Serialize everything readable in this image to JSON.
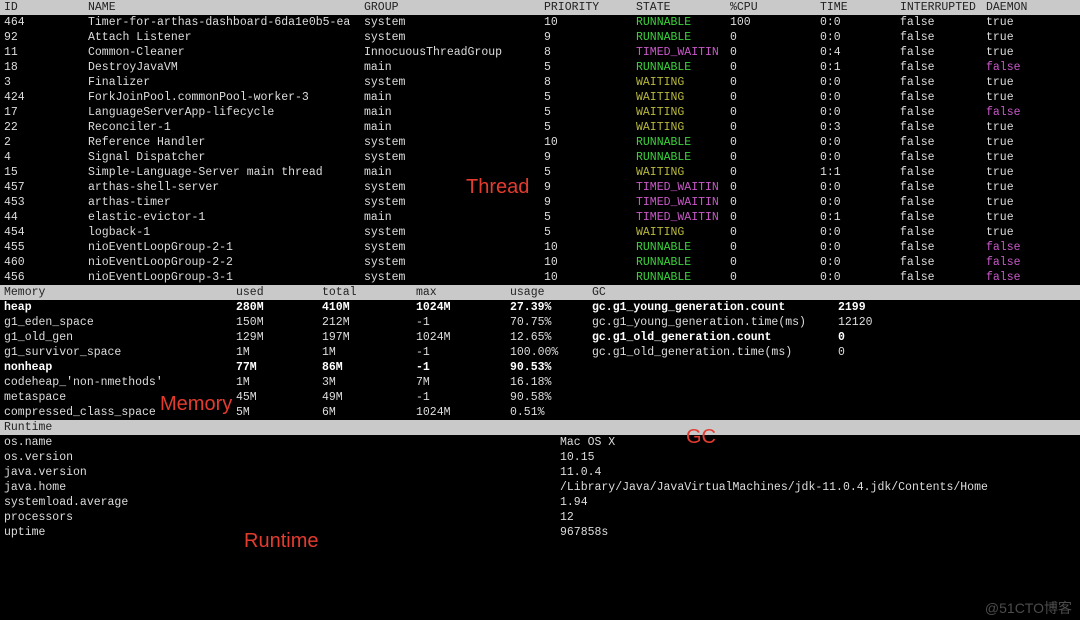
{
  "thread": {
    "headers": {
      "id": "ID",
      "name": "NAME",
      "group": "GROUP",
      "priority": "PRIORITY",
      "state": "STATE",
      "cpu": "%CPU",
      "time": "TIME",
      "interrupted": "INTERRUPTED",
      "daemon": "DAEMON"
    },
    "rows": [
      {
        "id": "464",
        "name": "Timer-for-arthas-dashboard-6da1e0b5-ea",
        "group": "system",
        "priority": "10",
        "state": "RUNNABLE",
        "state_c": "green",
        "cpu": "100",
        "time": "0:0",
        "interrupted": "false",
        "daemon": "true",
        "daemon_c": ""
      },
      {
        "id": "92",
        "name": "Attach Listener",
        "group": "system",
        "priority": "9",
        "state": "RUNNABLE",
        "state_c": "green",
        "cpu": "0",
        "time": "0:0",
        "interrupted": "false",
        "daemon": "true",
        "daemon_c": ""
      },
      {
        "id": "11",
        "name": "Common-Cleaner",
        "group": "InnocuousThreadGroup",
        "priority": "8",
        "state": "TIMED_WAITIN",
        "state_c": "magenta",
        "cpu": "0",
        "time": "0:4",
        "interrupted": "false",
        "daemon": "true",
        "daemon_c": ""
      },
      {
        "id": "18",
        "name": "DestroyJavaVM",
        "group": "main",
        "priority": "5",
        "state": "RUNNABLE",
        "state_c": "green",
        "cpu": "0",
        "time": "0:1",
        "interrupted": "false",
        "daemon": "false",
        "daemon_c": "magenta"
      },
      {
        "id": "3",
        "name": "Finalizer",
        "group": "system",
        "priority": "8",
        "state": "WAITING",
        "state_c": "olive",
        "cpu": "0",
        "time": "0:0",
        "interrupted": "false",
        "daemon": "true",
        "daemon_c": ""
      },
      {
        "id": "424",
        "name": "ForkJoinPool.commonPool-worker-3",
        "group": "main",
        "priority": "5",
        "state": "WAITING",
        "state_c": "olive",
        "cpu": "0",
        "time": "0:0",
        "interrupted": "false",
        "daemon": "true",
        "daemon_c": ""
      },
      {
        "id": "17",
        "name": "LanguageServerApp-lifecycle",
        "group": "main",
        "priority": "5",
        "state": "WAITING",
        "state_c": "olive",
        "cpu": "0",
        "time": "0:0",
        "interrupted": "false",
        "daemon": "false",
        "daemon_c": "magenta"
      },
      {
        "id": "22",
        "name": "Reconciler-1",
        "group": "main",
        "priority": "5",
        "state": "WAITING",
        "state_c": "olive",
        "cpu": "0",
        "time": "0:3",
        "interrupted": "false",
        "daemon": "true",
        "daemon_c": ""
      },
      {
        "id": "2",
        "name": "Reference Handler",
        "group": "system",
        "priority": "10",
        "state": "RUNNABLE",
        "state_c": "green",
        "cpu": "0",
        "time": "0:0",
        "interrupted": "false",
        "daemon": "true",
        "daemon_c": ""
      },
      {
        "id": "4",
        "name": "Signal Dispatcher",
        "group": "system",
        "priority": "9",
        "state": "RUNNABLE",
        "state_c": "green",
        "cpu": "0",
        "time": "0:0",
        "interrupted": "false",
        "daemon": "true",
        "daemon_c": ""
      },
      {
        "id": "15",
        "name": "Simple-Language-Server main thread",
        "group": "main",
        "priority": "5",
        "state": "WAITING",
        "state_c": "olive",
        "cpu": "0",
        "time": "1:1",
        "interrupted": "false",
        "daemon": "true",
        "daemon_c": ""
      },
      {
        "id": "457",
        "name": "arthas-shell-server",
        "group": "system",
        "priority": "9",
        "state": "TIMED_WAITIN",
        "state_c": "magenta",
        "cpu": "0",
        "time": "0:0",
        "interrupted": "false",
        "daemon": "true",
        "daemon_c": ""
      },
      {
        "id": "453",
        "name": "arthas-timer",
        "group": "system",
        "priority": "9",
        "state": "TIMED_WAITIN",
        "state_c": "magenta",
        "cpu": "0",
        "time": "0:0",
        "interrupted": "false",
        "daemon": "true",
        "daemon_c": ""
      },
      {
        "id": "44",
        "name": "elastic-evictor-1",
        "group": "main",
        "priority": "5",
        "state": "TIMED_WAITIN",
        "state_c": "magenta",
        "cpu": "0",
        "time": "0:1",
        "interrupted": "false",
        "daemon": "true",
        "daemon_c": ""
      },
      {
        "id": "454",
        "name": "logback-1",
        "group": "system",
        "priority": "5",
        "state": "WAITING",
        "state_c": "olive",
        "cpu": "0",
        "time": "0:0",
        "interrupted": "false",
        "daemon": "true",
        "daemon_c": ""
      },
      {
        "id": "455",
        "name": "nioEventLoopGroup-2-1",
        "group": "system",
        "priority": "10",
        "state": "RUNNABLE",
        "state_c": "green",
        "cpu": "0",
        "time": "0:0",
        "interrupted": "false",
        "daemon": "false",
        "daemon_c": "magenta"
      },
      {
        "id": "460",
        "name": "nioEventLoopGroup-2-2",
        "group": "system",
        "priority": "10",
        "state": "RUNNABLE",
        "state_c": "green",
        "cpu": "0",
        "time": "0:0",
        "interrupted": "false",
        "daemon": "false",
        "daemon_c": "magenta"
      },
      {
        "id": "456",
        "name": "nioEventLoopGroup-3-1",
        "group": "system",
        "priority": "10",
        "state": "RUNNABLE",
        "state_c": "green",
        "cpu": "0",
        "time": "0:0",
        "interrupted": "false",
        "daemon": "false",
        "daemon_c": "magenta"
      }
    ]
  },
  "mem": {
    "headers": {
      "name": "Memory",
      "used": "used",
      "total": "total",
      "max": "max",
      "usage": "usage",
      "gc": "GC"
    },
    "rows": [
      {
        "name": "heap",
        "used": "280M",
        "total": "410M",
        "max": "1024M",
        "usage": "27.39%",
        "bold": true,
        "gk": "gc.g1_young_generation.count",
        "gv": "2199",
        "gbold": true
      },
      {
        "name": "g1_eden_space",
        "used": "150M",
        "total": "212M",
        "max": "-1",
        "usage": "70.75%",
        "bold": false,
        "gk": "gc.g1_young_generation.time(ms)",
        "gv": "12120",
        "gbold": false
      },
      {
        "name": "g1_old_gen",
        "used": "129M",
        "total": "197M",
        "max": "1024M",
        "usage": "12.65%",
        "bold": false,
        "gk": "gc.g1_old_generation.count",
        "gv": "0",
        "gbold": true
      },
      {
        "name": "g1_survivor_space",
        "used": "1M",
        "total": "1M",
        "max": "-1",
        "usage": "100.00%",
        "bold": false,
        "gk": "gc.g1_old_generation.time(ms)",
        "gv": "0",
        "gbold": false
      },
      {
        "name": "nonheap",
        "used": "77M",
        "total": "86M",
        "max": "-1",
        "usage": "90.53%",
        "bold": true,
        "gk": "",
        "gv": "",
        "gbold": false
      },
      {
        "name": "codeheap_'non-nmethods'",
        "used": "1M",
        "total": "3M",
        "max": "7M",
        "usage": "16.18%",
        "bold": false,
        "gk": "",
        "gv": "",
        "gbold": false
      },
      {
        "name": "metaspace",
        "used": "45M",
        "total": "49M",
        "max": "-1",
        "usage": "90.58%",
        "bold": false,
        "gk": "",
        "gv": "",
        "gbold": false
      },
      {
        "name": "compressed_class_space",
        "used": "5M",
        "total": "6M",
        "max": "1024M",
        "usage": "0.51%",
        "bold": false,
        "gk": "",
        "gv": "",
        "gbold": false
      }
    ]
  },
  "runtime": {
    "header": "Runtime",
    "rows": [
      {
        "k": "os.name",
        "v": "Mac OS X"
      },
      {
        "k": "os.version",
        "v": "10.15"
      },
      {
        "k": "java.version",
        "v": "11.0.4"
      },
      {
        "k": "java.home",
        "v": "/Library/Java/JavaVirtualMachines/jdk-11.0.4.jdk/Contents/Home"
      },
      {
        "k": "systemload.average",
        "v": "1.94"
      },
      {
        "k": "processors",
        "v": "12"
      },
      {
        "k": "uptime",
        "v": "967858s"
      }
    ]
  },
  "anno": {
    "thread": "Thread",
    "memory": "Memory",
    "gc": "GC",
    "runtime": "Runtime"
  },
  "watermark": "@51CTO博客"
}
